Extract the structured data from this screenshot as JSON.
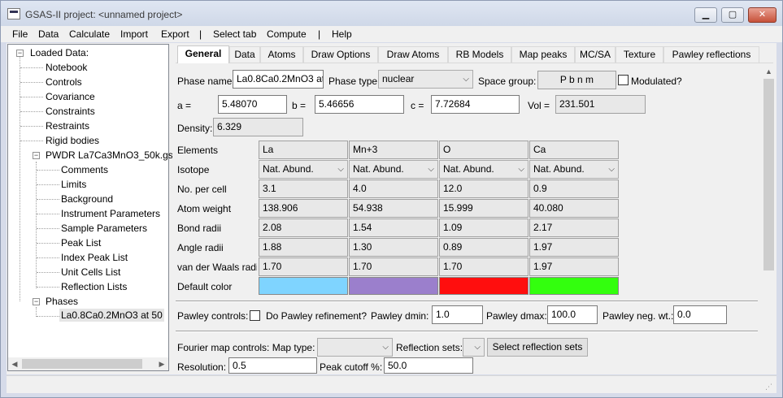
{
  "window": {
    "title": "GSAS-II project: <unnamed project>",
    "min": "▁",
    "max": "▢",
    "close": "✕"
  },
  "menu": [
    "File",
    "Data",
    "Calculate",
    "Import",
    "Export",
    "|",
    "Select tab",
    "Compute",
    "|",
    "Help"
  ],
  "tree": {
    "items": [
      {
        "label": "Loaded Data:",
        "expander": "−"
      },
      {
        "label": "Notebook"
      },
      {
        "label": "Controls"
      },
      {
        "label": "Covariance"
      },
      {
        "label": "Constraints"
      },
      {
        "label": "Restraints"
      },
      {
        "label": "Rigid bodies"
      },
      {
        "label": "PWDR La7Ca3MnO3_50k.gsa",
        "expander": "−"
      },
      {
        "label": "Comments"
      },
      {
        "label": "Limits"
      },
      {
        "label": "Background"
      },
      {
        "label": "Instrument Parameters"
      },
      {
        "label": "Sample Parameters"
      },
      {
        "label": "Peak List"
      },
      {
        "label": "Index Peak List"
      },
      {
        "label": "Unit Cells List"
      },
      {
        "label": "Reflection Lists"
      },
      {
        "label": "Phases",
        "expander": "−"
      },
      {
        "label": "La0.8Ca0.2MnO3 at 50"
      }
    ]
  },
  "tabs": [
    "General",
    "Data",
    "Atoms",
    "Draw Options",
    "Draw Atoms",
    "RB Models",
    "Map peaks",
    "MC/SA",
    "Texture",
    "Pawley reflections"
  ],
  "general": {
    "phase_name_label": "Phase name:",
    "phase_name": "La0.8Ca0.2MnO3 at",
    "phase_type_label": "Phase type:",
    "phase_type": "nuclear",
    "space_group_label": "Space group:",
    "space_group": "P b n m",
    "modulated_label": "Modulated?",
    "a_label": "a =",
    "a": "5.48070",
    "b_label": "b =",
    "b": "5.46656",
    "c_label": "c =",
    "c": "7.72684",
    "vol_label": "Vol =",
    "vol": "231.501",
    "density_label": "Density:",
    "density": "6.329"
  },
  "elements": {
    "row_labels": [
      "Elements",
      "Isotope",
      "No. per cell",
      "Atom weight",
      "Bond radii",
      "Angle radii",
      "van der Waals radii",
      "Default color"
    ],
    "columns": [
      {
        "element": "La",
        "isotope": "Nat. Abund.",
        "count": "3.1",
        "weight": "138.906",
        "bond": "2.08",
        "angle": "1.88",
        "vdw": "1.70",
        "color": "#7fd4ff"
      },
      {
        "element": "Mn+3",
        "isotope": "Nat. Abund.",
        "count": "4.0",
        "weight": "54.938",
        "bond": "1.54",
        "angle": "1.30",
        "vdw": "1.70",
        "color": "#9b7fcc"
      },
      {
        "element": "O",
        "isotope": "Nat. Abund.",
        "count": "12.0",
        "weight": "15.999",
        "bond": "1.09",
        "angle": "0.89",
        "vdw": "1.70",
        "color": "#ff0e0e"
      },
      {
        "element": "Ca",
        "isotope": "Nat. Abund.",
        "count": "0.9",
        "weight": "40.080",
        "bond": "2.17",
        "angle": "1.97",
        "vdw": "1.97",
        "color": "#33ff0e"
      }
    ]
  },
  "pawley": {
    "controls_label": "Pawley controls:",
    "refine_label": "Do Pawley refinement?",
    "dmin_label": "Pawley dmin:",
    "dmin": "1.0",
    "dmax_label": "Pawley dmax:",
    "dmax": "100.0",
    "negwt_label": "Pawley neg. wt.:",
    "negwt": "0.0"
  },
  "fourier": {
    "controls_label": "Fourier map controls: Map type:",
    "map_type": "",
    "refl_sets_label": "Reflection sets:",
    "select_button": "Select reflection sets",
    "resolution_label": "Resolution:",
    "resolution": "0.5",
    "cutoff_label": "Peak cutoff %:",
    "cutoff": "50.0"
  },
  "icons": {
    "dropdown": "⌵",
    "scroll_up": "▲",
    "scroll_left": "◀",
    "scroll_right": "▶"
  }
}
